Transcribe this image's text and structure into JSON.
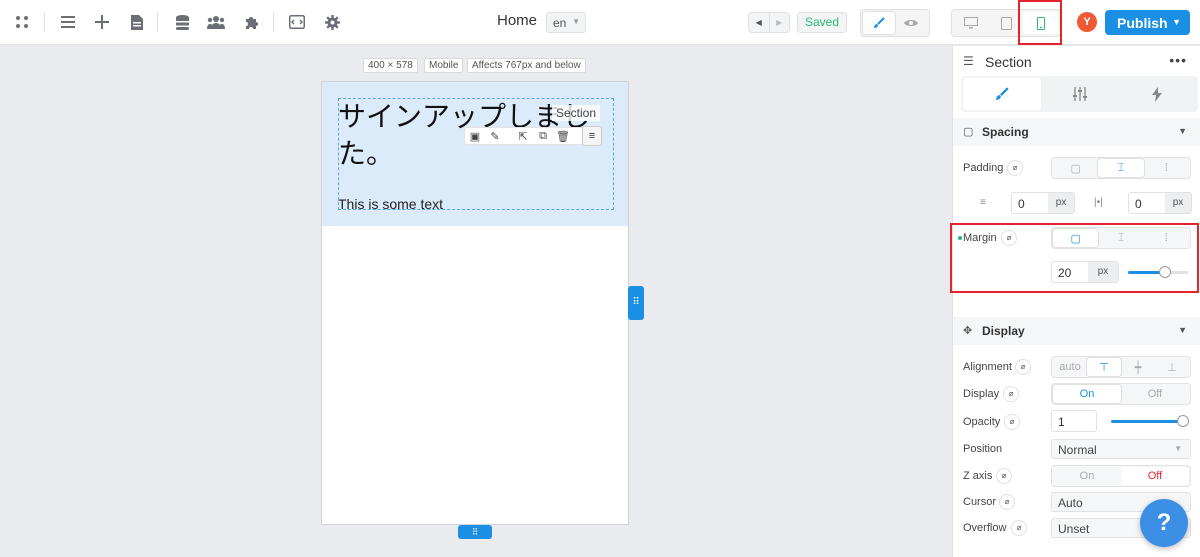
{
  "toolbar": {
    "left_icons": [
      "grid-icon",
      "list-icon",
      "plus-icon",
      "page-icon",
      "database-icon",
      "users-icon",
      "puzzle-icon",
      "code-icon",
      "gear-icon"
    ],
    "page_title": "Home",
    "language": "en",
    "saved_label": "Saved",
    "avatar_initial": "Y",
    "publish_label": "Publish"
  },
  "canvas": {
    "size_label": "400 × 578",
    "device_label": "Mobile",
    "affects_label": "Affects 767px and below",
    "heading_text": "サインアップしました。",
    "body_text": "This is some text",
    "section_badge": "Section"
  },
  "panel": {
    "title": "Section",
    "spacing": {
      "label": "Spacing",
      "padding_label": "Padding",
      "padding_vertical_value": "0",
      "padding_vertical_unit": "px",
      "padding_horizontal_value": "0",
      "padding_horizontal_unit": "px",
      "margin_label": "Margin",
      "margin_value": "20",
      "margin_unit": "px",
      "margin_slider_fraction": 0.62
    },
    "display": {
      "label": "Display",
      "alignment_label": "Alignment",
      "alignment_auto": "auto",
      "display_label": "Display",
      "display_on": "On",
      "display_off": "Off",
      "opacity_label": "Opacity",
      "opacity_value": "1",
      "opacity_slider_fraction": 1.0,
      "position_label": "Position",
      "position_value": "Normal",
      "zaxis_label": "Z axis",
      "zaxis_on": "On",
      "zaxis_off": "Off",
      "cursor_label": "Cursor",
      "cursor_value": "Auto",
      "overflow_label": "Overflow",
      "overflow_value": "Unset"
    }
  },
  "help_label": "?",
  "colors": {
    "accent": "#1a8fe3",
    "saved_green": "#2bb673",
    "highlight_red": "#e3252b"
  }
}
